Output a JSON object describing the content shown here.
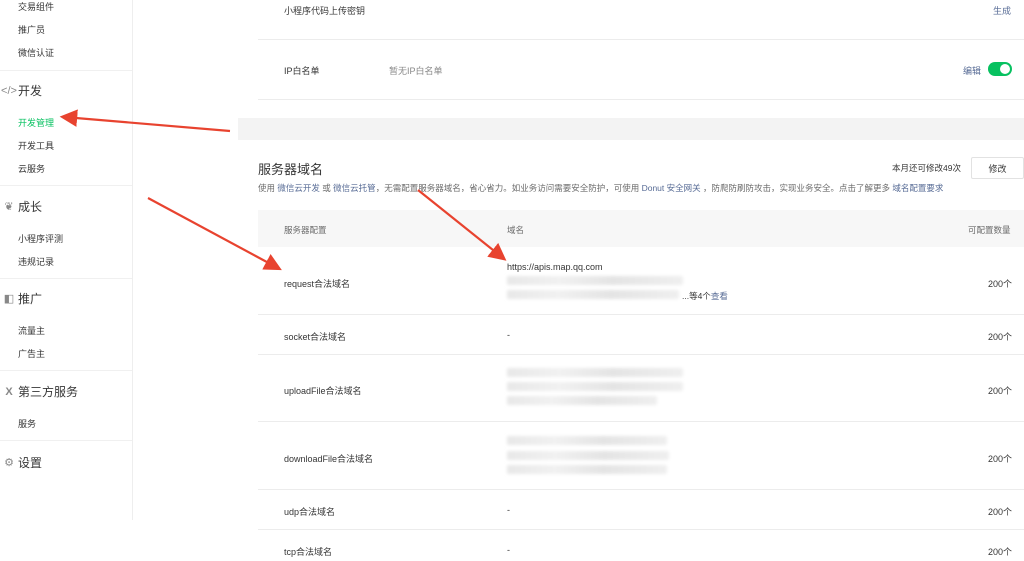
{
  "sidebar": {
    "items_top": [
      "交易组件",
      "推广员",
      "微信认证"
    ],
    "group_dev": {
      "icon": "code-icon",
      "label": "开发"
    },
    "dev_items": [
      "开发管理",
      "开发工具",
      "云服务"
    ],
    "group_growth": {
      "icon": "leaf-icon",
      "label": "成长"
    },
    "growth_items": [
      "小程序评测",
      "违规记录"
    ],
    "group_promo": {
      "icon": "megaphone-icon",
      "label": "推广"
    },
    "promo_items": [
      "流量主",
      "广告主"
    ],
    "group_third": {
      "icon": "x-icon",
      "label": "第三方服务"
    },
    "third_items": [
      "服务"
    ],
    "group_settings": {
      "icon": "gear-icon",
      "label": "设置"
    }
  },
  "top_card": {
    "upload_key_label": "小程序代码上传密钥",
    "generate_link": "生成",
    "ip_label": "IP白名单",
    "ip_value": "暂无IP白名单",
    "edit_link": "编辑"
  },
  "server_domain": {
    "title": "服务器域名",
    "remaining": "本月还可修改49次",
    "modify_button": "修改",
    "desc": {
      "p1": "使用",
      "l1": "微信云开发",
      "p2": "或",
      "l2": "微信云托管",
      "p3": "，无需配置服务器域名，省心省力。如业务访问需要安全防护，可使用",
      "l3": "Donut 安全网关",
      "p4": "，防爬防刷防攻击，实现业务安全。点击了解更多",
      "l4": "域名配置要求"
    },
    "columns": [
      "服务器配置",
      "域名",
      "可配置数量"
    ],
    "rows": [
      {
        "name": "request合法域名",
        "domain": "https://apis.map.qq.com",
        "more": "...等4个",
        "more_link": "查看",
        "count": "200个"
      },
      {
        "name": "socket合法域名",
        "domain": "-",
        "count": "200个"
      },
      {
        "name": "uploadFile合法域名",
        "domain": "",
        "count": "200个"
      },
      {
        "name": "downloadFile合法域名",
        "domain": "",
        "count": "200个"
      },
      {
        "name": "udp合法域名",
        "domain": "-",
        "count": "200个"
      },
      {
        "name": "tcp合法域名",
        "domain": "-",
        "count": "200个"
      }
    ]
  },
  "colors": {
    "accent": "#07c160",
    "link": "#576b95",
    "arrow": "#e8432f"
  }
}
